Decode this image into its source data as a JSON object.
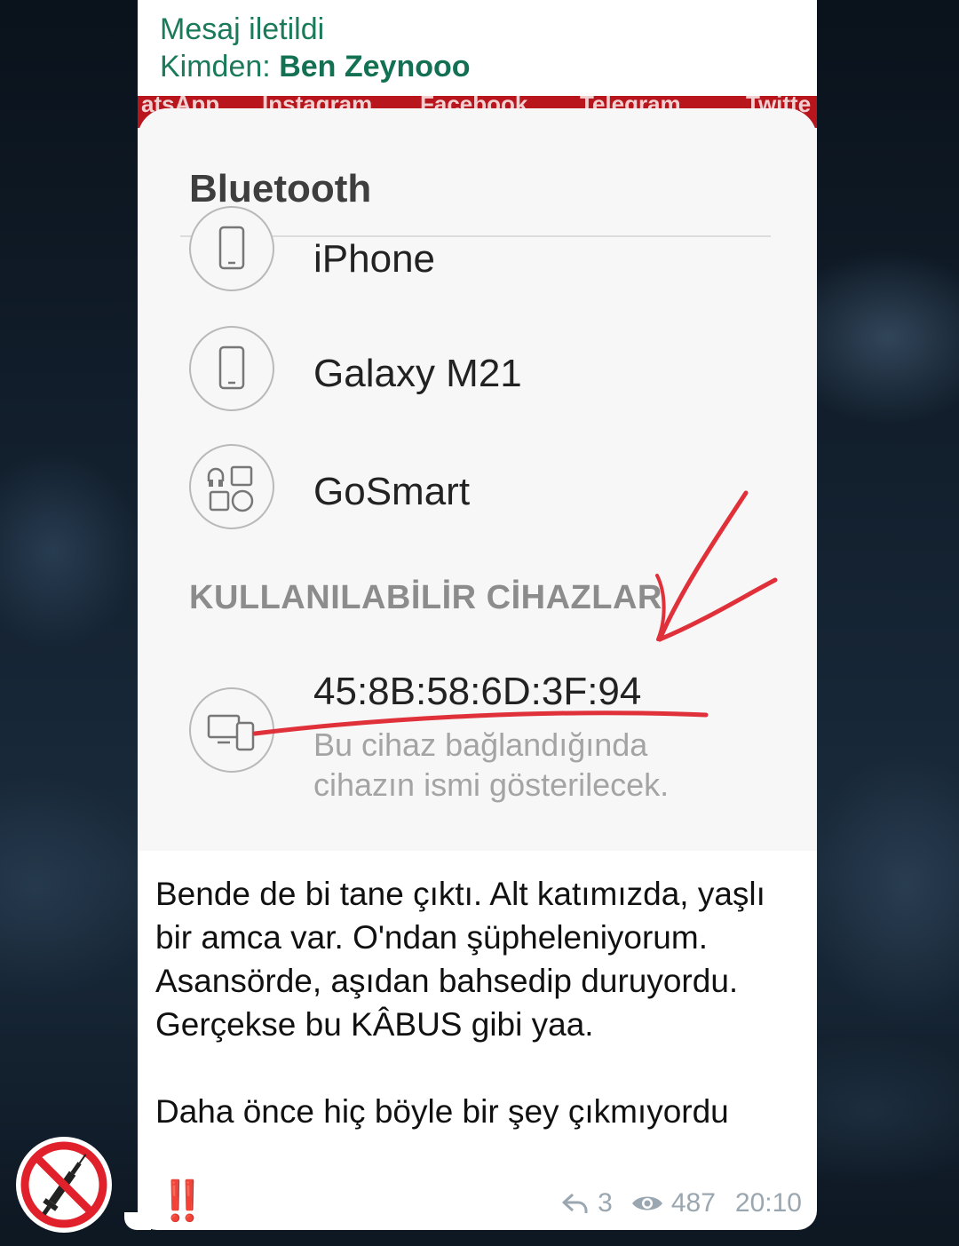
{
  "forward": {
    "title": "Mesaj iletildi",
    "from_label": "Kimden:",
    "from_name": "Ben Zeynooo"
  },
  "screenshot": {
    "top_strip_words": [
      "atsApp",
      "Instagram",
      "Facebook",
      "Telegram",
      "Twitte"
    ],
    "title": "Bluetooth",
    "paired_devices": [
      {
        "name": "iPhone",
        "icon": "phone-icon"
      },
      {
        "name": "Galaxy M21",
        "icon": "phone-icon"
      },
      {
        "name": "GoSmart",
        "icon": "apps-icon"
      }
    ],
    "section_label": "KULLANILABİLİR CİHAZLAR",
    "available_device": {
      "address": "45:8B:58:6D:3F:94",
      "hint": "Bu cihaz bağlandığında cihazın ismi gösterilecek.",
      "icon": "devices-icon"
    },
    "annotation_color": "#e0303a"
  },
  "message": {
    "paragraph1": "Bende de bi tane çıktı. Alt katımızda, yaşlı bir amca var. O'ndan şüpheleniyorum. Asansörde, aşıdan bahsedip duruyordu. Gerçekse bu KÂBUS gibi yaa.",
    "paragraph2": "Daha önce hiç böyle bir şey çıkmıyordu",
    "emoji": "‼️"
  },
  "meta": {
    "replies": "3",
    "views": "487",
    "time": "20:10"
  },
  "avatar": {
    "icon": "no-syringe-icon",
    "accent": "#e0202a"
  }
}
